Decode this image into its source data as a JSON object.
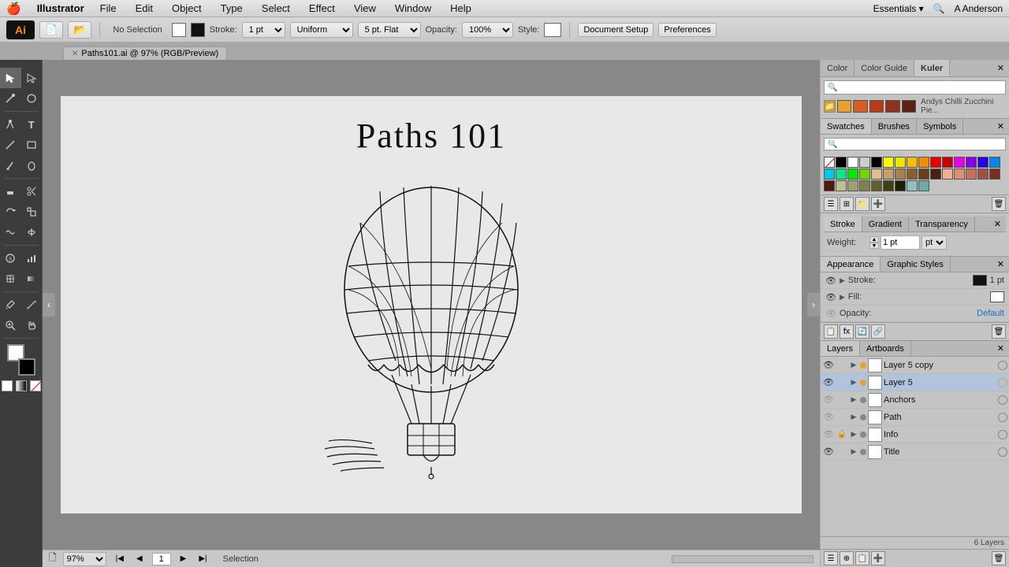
{
  "menubar": {
    "apple": "🍎",
    "app_name": "Illustrator",
    "items": [
      "File",
      "Edit",
      "Object",
      "Type",
      "Select",
      "Effect",
      "View",
      "Window",
      "Help"
    ],
    "user": "A Anderson",
    "essentials_label": "Essentials ▾"
  },
  "toolbar_top": {
    "no_selection": "No Selection",
    "stroke_label": "Stroke:",
    "stroke_value": "1 pt",
    "uniform_label": "Uniform",
    "flat_label": "5 pt. Flat",
    "opacity_label": "Opacity:",
    "opacity_value": "100%",
    "style_label": "Style:",
    "doc_setup_label": "Document Setup",
    "preferences_label": "Preferences"
  },
  "doc_tab": {
    "name": "Paths101.ai @ 97% (RGB/Preview)",
    "close": "✕"
  },
  "canvas": {
    "artwork_title": "Paths 101",
    "zoom_value": "97%",
    "page_num": "1",
    "tool_name": "Selection"
  },
  "color_panel": {
    "tabs": [
      "Color",
      "Color Guide",
      "Kuler"
    ],
    "active_tab": "Kuler",
    "search_placeholder": "🔍",
    "swatch_name": "Andys Chilli Zucchini Pie...",
    "swatches": [
      "#e8a030",
      "#d45f20",
      "#b83a18",
      "#903020",
      "#602010",
      "#c83818"
    ]
  },
  "swatches_panel": {
    "tabs": [
      "Swatches",
      "Brushes",
      "Symbols"
    ],
    "active_tab": "Swatches",
    "swatches": [
      "#f8f800",
      "#d4d400",
      "#b8b800",
      "#f8e800",
      "#000000",
      "#ffffff",
      "#cccccc",
      "#888888",
      "#444444",
      "#ff0000",
      "#cc0000",
      "#990000",
      "#660000",
      "#00ff00",
      "#00cc00",
      "#009900",
      "#006600",
      "#0000ff",
      "#0000cc",
      "#000099",
      "#000066",
      "#ffff00",
      "#ff00ff",
      "#00ffff",
      "#ff8800",
      "#8800ff",
      "#00ff88",
      "#ff0088",
      "#88ff00",
      "#f0c040",
      "#c08020",
      "#906010",
      "#604010",
      "#e06020",
      "#c04010",
      "#a03010",
      "#802010",
      "#c0b090",
      "#a09070",
      "#806050",
      "#604030",
      "#20c0c0",
      "#1090a0",
      "#086080",
      "#044060"
    ],
    "toolbar_icons": [
      "⬜",
      "📋",
      "📁",
      "🗑",
      "➕",
      "📊",
      "🔗",
      "🗑"
    ]
  },
  "stroke_panel": {
    "tabs": [
      "Stroke",
      "Gradient",
      "Transparency"
    ],
    "active_tab": "Stroke",
    "weight_label": "Weight:",
    "weight_value": "1 pt"
  },
  "appearance_panel": {
    "tabs": [
      "Appearance",
      "Graphic Styles"
    ],
    "active_tab": "Appearance",
    "rows": [
      {
        "visible": true,
        "expandable": true,
        "label": "Stroke:",
        "swatch_color": "#111111",
        "value": "1 pt",
        "is_link": false
      },
      {
        "visible": true,
        "expandable": true,
        "label": "Fill:",
        "swatch_color": "#ffffff",
        "value": "",
        "is_link": false
      },
      {
        "visible": false,
        "expandable": false,
        "label": "Opacity:",
        "value": "Default",
        "is_link": true
      }
    ],
    "toolbar_icons": [
      "📋",
      "⚡",
      "🔄",
      "🔗",
      "🗑"
    ]
  },
  "layers_panel": {
    "tabs": [
      "Layers",
      "Artboards"
    ],
    "active_tab": "Layers",
    "layers": [
      {
        "visible": true,
        "locked": false,
        "expanded": false,
        "color": "#e8a030",
        "name": "Layer 5 copy",
        "is_selected": false
      },
      {
        "visible": true,
        "locked": false,
        "expanded": true,
        "color": "#e8a030",
        "name": "Layer 5",
        "is_selected": true
      },
      {
        "visible": false,
        "locked": false,
        "expanded": false,
        "color": "#888888",
        "name": "Anchors",
        "is_selected": false
      },
      {
        "visible": false,
        "locked": false,
        "expanded": false,
        "color": "#888888",
        "name": "Path",
        "is_selected": false
      },
      {
        "visible": false,
        "locked": true,
        "expanded": false,
        "color": "#888888",
        "name": "Info",
        "is_selected": false
      },
      {
        "visible": true,
        "locked": false,
        "expanded": false,
        "color": "#888888",
        "name": "Title",
        "is_selected": false
      }
    ],
    "footer": "6 Layers"
  },
  "tools": [
    [
      "arrow",
      "direct-select"
    ],
    [
      "magic-wand",
      "lasso"
    ],
    [
      "pen",
      "text"
    ],
    [
      "line",
      "rect"
    ],
    [
      "paintbrush",
      "blob-brush"
    ],
    [
      "eraser",
      "scissors"
    ],
    [
      "rotate",
      "scale"
    ],
    [
      "warp",
      "width"
    ],
    [
      "free-transform",
      "shape-builder"
    ],
    [
      "symbol",
      "graph"
    ],
    [
      "mesh",
      "gradient"
    ],
    [
      "eyedropper",
      "measure"
    ],
    [
      "zoom",
      "hand"
    ]
  ]
}
